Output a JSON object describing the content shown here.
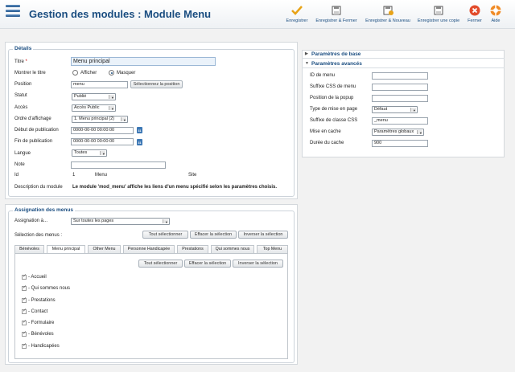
{
  "header": {
    "title": "Gestion des modules : Module Menu",
    "buttons": [
      {
        "label": "Enregistrer",
        "icon": "check-icon"
      },
      {
        "label": "Enregistrer & Fermer",
        "icon": "save-close-icon"
      },
      {
        "label": "Enregistrer & Nouveau",
        "icon": "save-new-icon"
      },
      {
        "label": "Enregistrer une copie",
        "icon": "save-copy-icon"
      },
      {
        "label": "Fermer",
        "icon": "close-icon"
      },
      {
        "label": "Aide",
        "icon": "help-icon"
      }
    ]
  },
  "details": {
    "legend": "Détails",
    "title_label": "Titre",
    "title_required": "*",
    "title_value": "Menu principal",
    "show_title_label": "Montrer le titre",
    "show_option": "Afficher",
    "hide_option": "Masquer",
    "position_label": "Position",
    "position_value": "menu",
    "position_button": "Sélectionnez la position",
    "status_label": "Statut",
    "status_value": "Publié",
    "access_label": "Accès",
    "access_value": "Accès Public",
    "order_label": "Ordre d'affichage",
    "order_value": "1. Menu principal (2)",
    "pub_start_label": "Début de publication",
    "pub_start_value": "0000-00-00 00:00:00",
    "pub_end_label": "Fin de publication",
    "pub_end_value": "0000-00-00 00:00:00",
    "calendar_day": "31",
    "language_label": "Langue",
    "language_value": "Toutes",
    "note_label": "Note",
    "note_value": "",
    "id_label": "Id",
    "id_value": "1",
    "id_menu": "Menu",
    "id_site": "Site",
    "desc_label": "Description du module",
    "desc_value": "Le module 'mod_menu' affiche les liens d'un menu spécifié selon les paramètres choisis."
  },
  "params": {
    "basic_header": "Paramètres de base",
    "advanced_header": "Paramètres avancés",
    "fields": [
      {
        "label": "ID de menu",
        "value": "",
        "type": "input"
      },
      {
        "label": "Suffixe CSS de menu",
        "value": "",
        "type": "input"
      },
      {
        "label": "Position de la popup",
        "value": "",
        "type": "input"
      },
      {
        "label": "Type de mise en page",
        "value": "Défaut",
        "type": "select"
      },
      {
        "label": "Suffixe de classe CSS",
        "value": "_menu",
        "type": "input"
      },
      {
        "label": "Mise en cache",
        "value": "Paramètres globaux",
        "type": "select"
      },
      {
        "label": "Durée du cache",
        "value": "900",
        "type": "input"
      }
    ]
  },
  "assignment": {
    "legend": "Assignation des menus",
    "assign_label": "Assignation à...",
    "assign_value": "Sur toutes les pages",
    "selection_label": "Sélection des menus :",
    "select_all": "Tout sélectionner",
    "clear_selection": "Effacer la sélection",
    "invert_selection": "Inverser la sélection",
    "tabs": [
      "Bénévoles",
      "Menu principal",
      "Other Menu",
      "Personne Handicapée",
      "Prestations",
      "Qui sommes nous",
      "Top Menu"
    ],
    "inner_select_all": "Tout sélectionner",
    "inner_clear": "Effacer la sélection",
    "inner_invert": "Inverser la sélection",
    "items": [
      "- Accueil",
      "- Qui sommes nous",
      "- Prestations",
      "- Contact",
      "- Formulaire",
      "- Bénévoles",
      "- Handicapées"
    ]
  }
}
